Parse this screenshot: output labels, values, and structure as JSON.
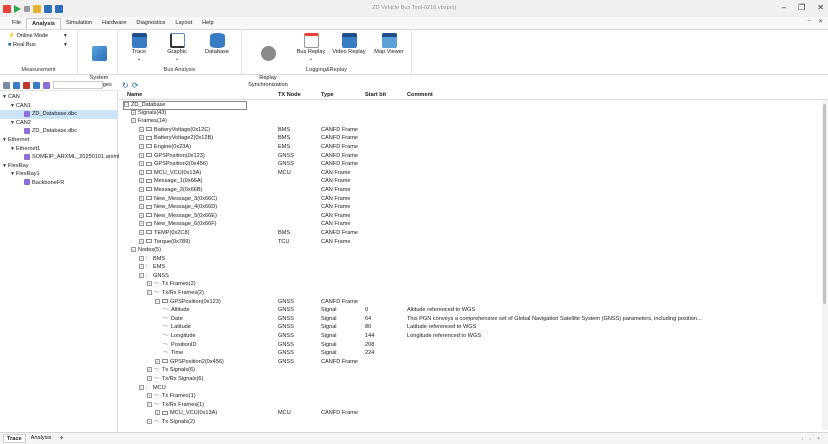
{
  "window": {
    "title": "ZD Vehicle Bus Tool-0216.vbsproj",
    "controls": [
      "minimize-icon",
      "restore-icon",
      "close-icon"
    ]
  },
  "menu": {
    "items": [
      "File",
      "Analysis",
      "Simulation",
      "Hardware",
      "Diagnostics",
      "Layout",
      "Help"
    ],
    "active": "Analysis"
  },
  "ribbon": {
    "online_mode": "Online Mode",
    "real_bus": "Real Bus",
    "system_messages": "System\nMessages",
    "measurement_label": "Measurement",
    "trace": "Trace",
    "graphic": "Graphic",
    "database": "Database",
    "bus_analysis_label": "Bus Analysis",
    "replay_sync": "Replay\nSynchronization",
    "bus_replay": "Bus Replay",
    "video_replay": "Video Replay",
    "map_viewer": "Map Viewer",
    "logging_label": "Logging&Replay"
  },
  "left_tree": [
    {
      "depth": 0,
      "arrow": "▼",
      "label": "CAN"
    },
    {
      "depth": 1,
      "arrow": "▼",
      "label": "CAN1"
    },
    {
      "depth": 2,
      "arrow": "",
      "label": "ZD_Database.dbc",
      "db": true,
      "selected": true
    },
    {
      "depth": 1,
      "arrow": "▼",
      "label": "CAN2"
    },
    {
      "depth": 2,
      "arrow": "",
      "label": "ZD_Database.dbc",
      "db": true
    },
    {
      "depth": 0,
      "arrow": "▼",
      "label": "Ethernet"
    },
    {
      "depth": 1,
      "arrow": "▼",
      "label": "Ethernet1"
    },
    {
      "depth": 2,
      "arrow": "",
      "label": "SOMEIP_ARXML_20250101.arxml",
      "db": true
    },
    {
      "depth": 0,
      "arrow": "▼",
      "label": "FlexRay"
    },
    {
      "depth": 1,
      "arrow": "▼",
      "label": "FlexRay1"
    },
    {
      "depth": 2,
      "arrow": "",
      "label": "BackboneFR",
      "db": true
    }
  ],
  "columns": {
    "name": "Name",
    "tx_node": "TX Node",
    "type": "Type",
    "start_bit": "Start bit",
    "comment": "Comment"
  },
  "rows": [
    {
      "d": 0,
      "e": "⊟",
      "ic": "",
      "name": "ZD_Database",
      "tx": "",
      "type": "",
      "sb": "",
      "cm": "",
      "box": true
    },
    {
      "d": 1,
      "e": "⊞",
      "ic": "",
      "name": "Signals(43)",
      "tx": "",
      "type": "",
      "sb": "",
      "cm": ""
    },
    {
      "d": 1,
      "e": "⊟",
      "ic": "",
      "name": "Frames(14)",
      "tx": "",
      "type": "",
      "sb": "",
      "cm": ""
    },
    {
      "d": 2,
      "e": "⊞",
      "ic": "f",
      "name": "BatteryVoltage(0x12C)",
      "tx": "BMS",
      "type": "CANFD Frame",
      "sb": "",
      "cm": ""
    },
    {
      "d": 2,
      "e": "⊞",
      "ic": "f",
      "name": "BatteryVoltage2(0x12B)",
      "tx": "BMS",
      "type": "CANFD Frame",
      "sb": "",
      "cm": ""
    },
    {
      "d": 2,
      "e": "⊞",
      "ic": "f",
      "name": "Engine(0x23A)",
      "tx": "EMS",
      "type": "CANFD Frame",
      "sb": "",
      "cm": ""
    },
    {
      "d": 2,
      "e": "⊞",
      "ic": "f",
      "name": "GPSPosition(0x123)",
      "tx": "GNSS",
      "type": "CANFD Frame",
      "sb": "",
      "cm": ""
    },
    {
      "d": 2,
      "e": "⊞",
      "ic": "f",
      "name": "GPSPosition2(0x456)",
      "tx": "GNSS",
      "type": "CANFD Frame",
      "sb": "",
      "cm": ""
    },
    {
      "d": 2,
      "e": "⊞",
      "ic": "f",
      "name": "MCU_VCU(0x13A)",
      "tx": "MCU",
      "type": "CAN Frame",
      "sb": "",
      "cm": ""
    },
    {
      "d": 2,
      "e": "⊞",
      "ic": "f",
      "name": "Message_1(0x66A)",
      "tx": "",
      "type": "CAN Frame",
      "sb": "",
      "cm": ""
    },
    {
      "d": 2,
      "e": "⊞",
      "ic": "f",
      "name": "Message_2(0x66B)",
      "tx": "",
      "type": "CAN Frame",
      "sb": "",
      "cm": ""
    },
    {
      "d": 2,
      "e": "⊞",
      "ic": "f",
      "name": "New_Message_3(0x66C)",
      "tx": "",
      "type": "CAN Frame",
      "sb": "",
      "cm": ""
    },
    {
      "d": 2,
      "e": "⊞",
      "ic": "f",
      "name": "New_Message_4(0x66D)",
      "tx": "",
      "type": "CAN Frame",
      "sb": "",
      "cm": ""
    },
    {
      "d": 2,
      "e": "⊞",
      "ic": "f",
      "name": "New_Message_5(0x66E)",
      "tx": "",
      "type": "CAN Frame",
      "sb": "",
      "cm": ""
    },
    {
      "d": 2,
      "e": "⊞",
      "ic": "f",
      "name": "New_Message_6(0x66F)",
      "tx": "",
      "type": "CAN Frame",
      "sb": "",
      "cm": ""
    },
    {
      "d": 2,
      "e": "⊞",
      "ic": "f",
      "name": "TEMP(0x2C8)",
      "tx": "BMS",
      "type": "CANFD Frame",
      "sb": "",
      "cm": ""
    },
    {
      "d": 2,
      "e": "⊞",
      "ic": "f",
      "name": "Torque(0x789)",
      "tx": "TCU",
      "type": "CAN Frame",
      "sb": "",
      "cm": ""
    },
    {
      "d": 1,
      "e": "⊟",
      "ic": "",
      "name": "Nodes(5)",
      "tx": "",
      "type": "",
      "sb": "",
      "cm": ""
    },
    {
      "d": 2,
      "e": "⊞",
      "ic": "n",
      "name": "BMS",
      "tx": "",
      "type": "",
      "sb": "",
      "cm": ""
    },
    {
      "d": 2,
      "e": "⊞",
      "ic": "n",
      "name": "EMS",
      "tx": "",
      "type": "",
      "sb": "",
      "cm": ""
    },
    {
      "d": 2,
      "e": "⊟",
      "ic": "n",
      "name": "GNSS",
      "tx": "",
      "type": "",
      "sb": "",
      "cm": ""
    },
    {
      "d": 3,
      "e": "⊞",
      "ic": "s",
      "name": "Tx Frames(2)",
      "tx": "",
      "type": "",
      "sb": "",
      "cm": ""
    },
    {
      "d": 3,
      "e": "⊟",
      "ic": "s",
      "name": "Tx/Rx Frames(2)",
      "tx": "",
      "type": "",
      "sb": "",
      "cm": ""
    },
    {
      "d": 4,
      "e": "⊟",
      "ic": "f",
      "name": "GPSPosition(0x123)",
      "tx": "GNSS",
      "type": "CANFD Frame",
      "sb": "",
      "cm": ""
    },
    {
      "d": 5,
      "e": "",
      "ic": "s",
      "name": "Altitude",
      "tx": "GNSS",
      "type": "Signal",
      "sb": "0",
      "cm": "Altitude referenced to WGS"
    },
    {
      "d": 5,
      "e": "",
      "ic": "s",
      "name": "Date",
      "tx": "GNSS",
      "type": "Signal",
      "sb": "64",
      "cm": "This PGN conveys a comprehensive set of Global Navigation Satellite System (GNSS) parameters, including position..."
    },
    {
      "d": 5,
      "e": "",
      "ic": "s",
      "name": "Latitude",
      "tx": "GNSS",
      "type": "Signal",
      "sb": "80",
      "cm": "Latitude referenced to WGS"
    },
    {
      "d": 5,
      "e": "",
      "ic": "s",
      "name": "Longitude",
      "tx": "GNSS",
      "type": "Signal",
      "sb": "144",
      "cm": "Longitude referenced to WGS"
    },
    {
      "d": 5,
      "e": "",
      "ic": "s",
      "name": "PositionID",
      "tx": "GNSS",
      "type": "Signal",
      "sb": "208",
      "cm": ""
    },
    {
      "d": 5,
      "e": "",
      "ic": "s",
      "name": "Time",
      "tx": "GNSS",
      "type": "Signal",
      "sb": "224",
      "cm": ""
    },
    {
      "d": 4,
      "e": "⊞",
      "ic": "f",
      "name": "GPSPosition2(0x456)",
      "tx": "GNSS",
      "type": "CANFD Frame",
      "sb": "",
      "cm": ""
    },
    {
      "d": 3,
      "e": "⊞",
      "ic": "s",
      "name": "Tx Signals(6)",
      "tx": "",
      "type": "",
      "sb": "",
      "cm": ""
    },
    {
      "d": 3,
      "e": "⊞",
      "ic": "s",
      "name": "Tx/Rx Signals(6)",
      "tx": "",
      "type": "",
      "sb": "",
      "cm": ""
    },
    {
      "d": 2,
      "e": "⊟",
      "ic": "n",
      "name": "MCU",
      "tx": "",
      "type": "",
      "sb": "",
      "cm": ""
    },
    {
      "d": 3,
      "e": "⊞",
      "ic": "s",
      "name": "Tx Frames(1)",
      "tx": "",
      "type": "",
      "sb": "",
      "cm": ""
    },
    {
      "d": 3,
      "e": "⊟",
      "ic": "s",
      "name": "Tx/Rx Frames(1)",
      "tx": "",
      "type": "",
      "sb": "",
      "cm": ""
    },
    {
      "d": 4,
      "e": "⊞",
      "ic": "f",
      "name": "MCU_VCU(0x13A)",
      "tx": "MCU",
      "type": "CANFD Frame",
      "sb": "",
      "cm": ""
    },
    {
      "d": 3,
      "e": "⊞",
      "ic": "s",
      "name": "Tx Signals(2)",
      "tx": "",
      "type": "",
      "sb": "",
      "cm": ""
    }
  ],
  "bottom_tabs": {
    "trace": "Trace",
    "analysis": "Analysis",
    "add": "+"
  }
}
